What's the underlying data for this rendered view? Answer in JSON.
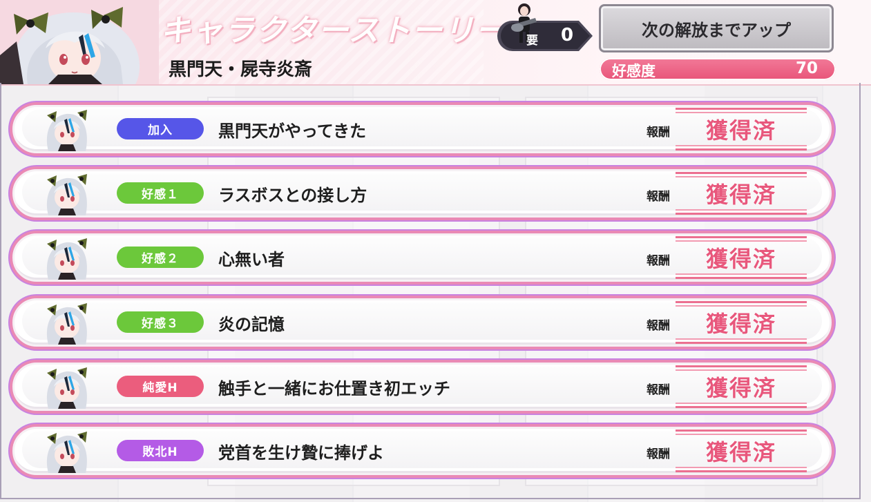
{
  "header": {
    "title": "キャラクターストーリー",
    "character_name": "黒門天・屍寺炎斎",
    "requirement_label": "要",
    "requirement_value": "0",
    "unlock_button_label": "次の解放までアップ",
    "affection_label": "好感度",
    "affection_value": "70"
  },
  "rows": [
    {
      "tag": "加入",
      "tag_color": "#5656e8",
      "title": "黒門天がやってきた",
      "reward_label": "報酬",
      "reward_status": "獲得済"
    },
    {
      "tag": "好感１",
      "tag_color": "#6cc83b",
      "title": "ラスボスとの接し方",
      "reward_label": "報酬",
      "reward_status": "獲得済"
    },
    {
      "tag": "好感２",
      "tag_color": "#6cc83b",
      "title": "心無い者",
      "reward_label": "報酬",
      "reward_status": "獲得済"
    },
    {
      "tag": "好感３",
      "tag_color": "#6cc83b",
      "title": "炎の記憶",
      "reward_label": "報酬",
      "reward_status": "獲得済"
    },
    {
      "tag": "純愛H",
      "tag_color": "#eb5d7d",
      "title": "触手と一緒にお仕置き初エッチ",
      "reward_label": "報酬",
      "reward_status": "獲得済"
    },
    {
      "tag": "敗北H",
      "tag_color": "#b45be6",
      "title": "党首を生け贄に捧げよ",
      "reward_label": "報酬",
      "reward_status": "獲得済"
    }
  ],
  "icons": {
    "requirement": "musician-icon",
    "row_avatar": "character-avatar-icon",
    "stamp": "obtained-stamp-icon"
  }
}
